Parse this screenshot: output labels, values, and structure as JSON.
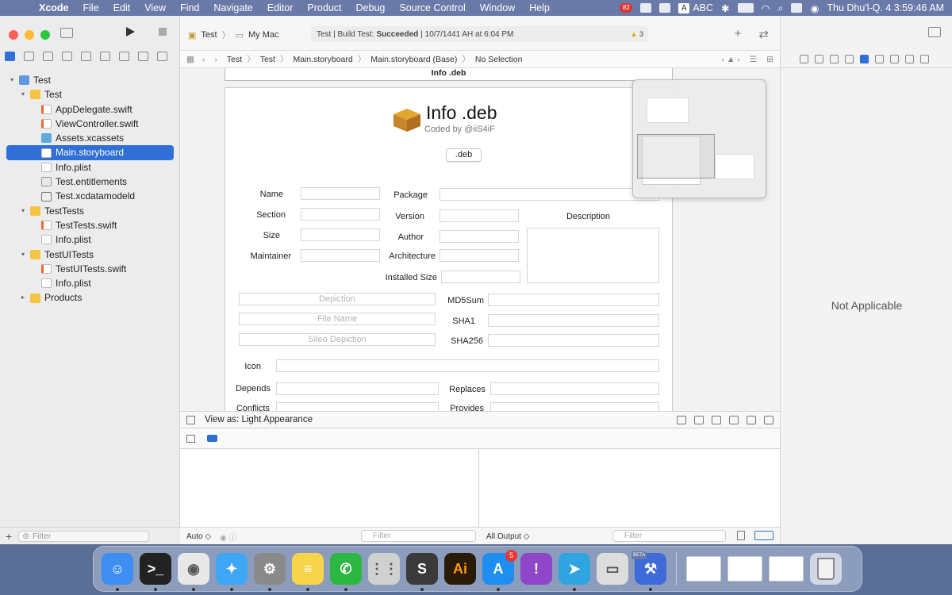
{
  "menubar": {
    "app_name": "Xcode",
    "items": [
      "File",
      "Edit",
      "View",
      "Find",
      "Navigate",
      "Editor",
      "Product",
      "Debug",
      "Source Control",
      "Window",
      "Help"
    ],
    "input_source": "ABC",
    "input_letter": "A",
    "notif_count": "82",
    "datetime": "Thu Dhu'l-Q. 4  3:59:46 AM"
  },
  "toolbar": {
    "scheme": "Test",
    "destination": "My Mac",
    "status_prefix": "Test | Build Test:",
    "status_result": "Succeeded",
    "status_suffix": "| 10/7/1441 AH at 6:04 PM",
    "warning_count": "3"
  },
  "jumpbar": {
    "crumbs": [
      "Test",
      "Test",
      "Main.storyboard",
      "Main.storyboard (Base)",
      "No Selection"
    ]
  },
  "navigator": {
    "items": [
      {
        "label": "Test",
        "indent": 0,
        "icon": "proj",
        "disc": "▾"
      },
      {
        "label": "Test",
        "indent": 1,
        "icon": "folder",
        "disc": "▾"
      },
      {
        "label": "AppDelegate.swift",
        "indent": 2,
        "icon": "swift",
        "disc": ""
      },
      {
        "label": "ViewController.swift",
        "indent": 2,
        "icon": "swift",
        "disc": ""
      },
      {
        "label": "Assets.xcassets",
        "indent": 2,
        "icon": "assets",
        "disc": ""
      },
      {
        "label": "Main.storyboard",
        "indent": 2,
        "icon": "file",
        "disc": "",
        "selected": true
      },
      {
        "label": "Info.plist",
        "indent": 2,
        "icon": "file",
        "disc": ""
      },
      {
        "label": "Test.entitlements",
        "indent": 2,
        "icon": "ent",
        "disc": ""
      },
      {
        "label": "Test.xcdatamodeld",
        "indent": 2,
        "icon": "model",
        "disc": ""
      },
      {
        "label": "TestTests",
        "indent": 1,
        "icon": "folder",
        "disc": "▾"
      },
      {
        "label": "TestTests.swift",
        "indent": 2,
        "icon": "swift",
        "disc": ""
      },
      {
        "label": "Info.plist",
        "indent": 2,
        "icon": "file",
        "disc": ""
      },
      {
        "label": "TestUITests",
        "indent": 1,
        "icon": "folder",
        "disc": "▾"
      },
      {
        "label": "TestUITests.swift",
        "indent": 2,
        "icon": "swift",
        "disc": ""
      },
      {
        "label": "Info.plist",
        "indent": 2,
        "icon": "file",
        "disc": ""
      },
      {
        "label": "Products",
        "indent": 1,
        "icon": "folder",
        "disc": "▸"
      }
    ],
    "filter_placeholder": "Filter"
  },
  "scene": {
    "window_title": "Info .deb",
    "title": "Info .deb",
    "subtitle": "Coded by @iiS4iF",
    "button": ".deb",
    "labels": {
      "name": "Name",
      "section": "Section",
      "size": "Size",
      "maintainer": "Maintainer",
      "package": "Package",
      "version": "Version",
      "author": "Author",
      "architecture": "Architecture",
      "installed_size": "Installed Size",
      "description": "Description",
      "md5": "MD5Sum",
      "sha1": "SHA1",
      "sha256": "SHA256",
      "icon": "Icon",
      "depends": "Depends",
      "replaces": "Replaces",
      "conflicts": "Conflicts",
      "provides": "Provides"
    },
    "placeholders": {
      "depiction": "Depiction",
      "file_name": "File Name",
      "sileo": "Sileo Depiction"
    }
  },
  "view_as": "View as: Light Appearance",
  "debug": {
    "auto": "Auto ◇",
    "filter": "Filter",
    "all_output": "All Output ◇",
    "filter2": "Filter"
  },
  "inspector": {
    "not_applicable": "Not Applicable"
  },
  "dock": {
    "apps": [
      {
        "name": "finder-app",
        "color": "#3d8ef0",
        "glyph": "☺"
      },
      {
        "name": "terminal-app",
        "color": "#222",
        "glyph": ">_"
      },
      {
        "name": "chrome-app",
        "color": "#e8e8e8",
        "glyph": "◉"
      },
      {
        "name": "safari-app",
        "color": "#3ea6f5",
        "glyph": "✦"
      },
      {
        "name": "system-prefs-app",
        "color": "#8a8a8a",
        "glyph": "⚙"
      },
      {
        "name": "notes-app",
        "color": "#f7d54a",
        "glyph": "≡"
      },
      {
        "name": "whatsapp-app",
        "color": "#2bb741",
        "glyph": "✆"
      },
      {
        "name": "launchpad-app",
        "color": "#d0d0d0",
        "glyph": "⋮⋮"
      },
      {
        "name": "sublime-app",
        "color": "#3a3a3a",
        "glyph": "S"
      },
      {
        "name": "illustrator-app",
        "color": "#2a1a08",
        "glyph": "Ai"
      },
      {
        "name": "app-store-app",
        "color": "#1e8ef0",
        "glyph": "A",
        "badge": "5"
      },
      {
        "name": "feedback-app",
        "color": "#9046c8",
        "glyph": "!"
      },
      {
        "name": "telegram-app",
        "color": "#2ea4e0",
        "glyph": "➤"
      },
      {
        "name": "ipad-app",
        "color": "#ddd",
        "glyph": "▭"
      },
      {
        "name": "xcode-app",
        "color": "#3e6bd8",
        "glyph": "⚒"
      }
    ],
    "badge_beta": "BETA"
  }
}
